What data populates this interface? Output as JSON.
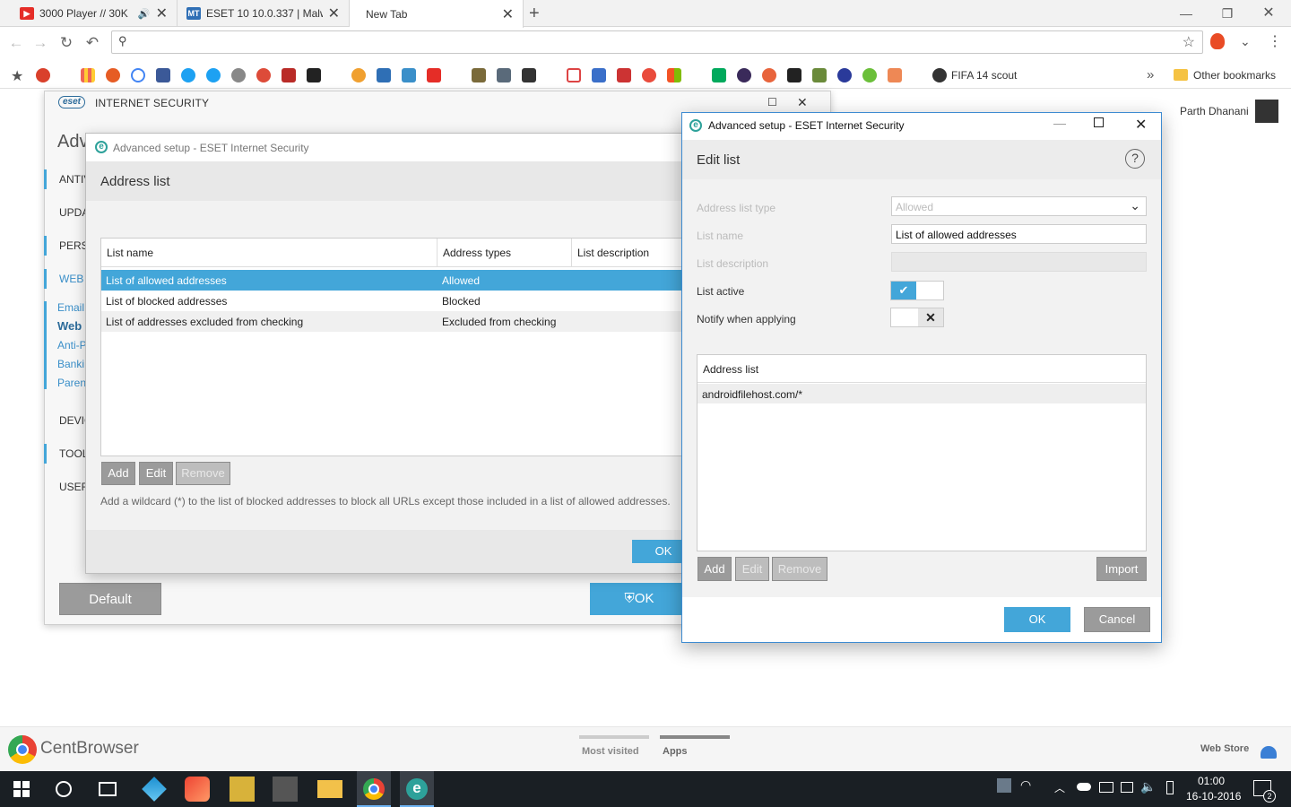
{
  "browser": {
    "tabs": [
      {
        "label": "3000 Player // 30K",
        "icon": "youtube-icon",
        "color": "#e52d27",
        "audio": true
      },
      {
        "label": "ESET 10 10.0.337 | Malw",
        "icon": "mt-icon",
        "color": "#2f6fb5"
      },
      {
        "label": "New Tab",
        "active": true
      }
    ],
    "omnibox_placeholder": "",
    "bookmarks_right": [
      "FIFA 14 scout",
      "Other bookmarks"
    ],
    "user_name": "Parth Dhanani",
    "overflow_label": "»",
    "newtab": {
      "brand": "CentBrowser",
      "tabs": [
        "Most visited",
        "Apps"
      ],
      "webstore": "Web Store"
    }
  },
  "eset_main": {
    "brand": "eset",
    "product": "INTERNET SECURITY",
    "heading": "Adv",
    "sidebar": [
      "ANTIV",
      "UPDA",
      "PERSO",
      "WEB A",
      "DEVIC",
      "TOOL",
      "USER"
    ],
    "sublinks": [
      "Email",
      "Web",
      "Anti-P",
      "Banki",
      "Paren"
    ],
    "default_button": "Default",
    "ok_button": "OK"
  },
  "address_dialog": {
    "title": "Advanced setup - ESET Internet Security",
    "section": "Address list",
    "columns": [
      "List name",
      "Address types",
      "List description"
    ],
    "rows": [
      {
        "name": "List of allowed addresses",
        "type": "Allowed",
        "selected": true
      },
      {
        "name": "List of blocked addresses",
        "type": "Blocked"
      },
      {
        "name": "List of addresses excluded from checking",
        "type": "Excluded from checking"
      }
    ],
    "buttons": {
      "add": "Add",
      "edit": "Edit",
      "remove": "Remove"
    },
    "hint": "Add a wildcard (*) to the list of blocked addresses to block all URLs except those included in a list of allowed addresses.",
    "ok": "OK"
  },
  "edit_dialog": {
    "title": "Advanced setup - ESET Internet Security",
    "heading": "Edit list",
    "help": "?",
    "fields": {
      "type_label": "Address list type",
      "type_value": "Allowed",
      "name_label": "List name",
      "name_value": "List of allowed addresses",
      "desc_label": "List description",
      "desc_value": "",
      "active_label": "List active",
      "notify_label": "Notify when applying"
    },
    "list_header": "Address list",
    "entries": [
      "androidfilehost.com/*"
    ],
    "buttons": {
      "add": "Add",
      "edit": "Edit",
      "remove": "Remove",
      "import": "Import",
      "ok": "OK",
      "cancel": "Cancel"
    }
  },
  "taskbar": {
    "time": "01:00",
    "date": "16-10-2016",
    "notifications": "2"
  },
  "colors": {
    "eset_blue": "#43a6d9",
    "eset_teal": "#2da19a",
    "selected_row": "#43a6d9"
  }
}
